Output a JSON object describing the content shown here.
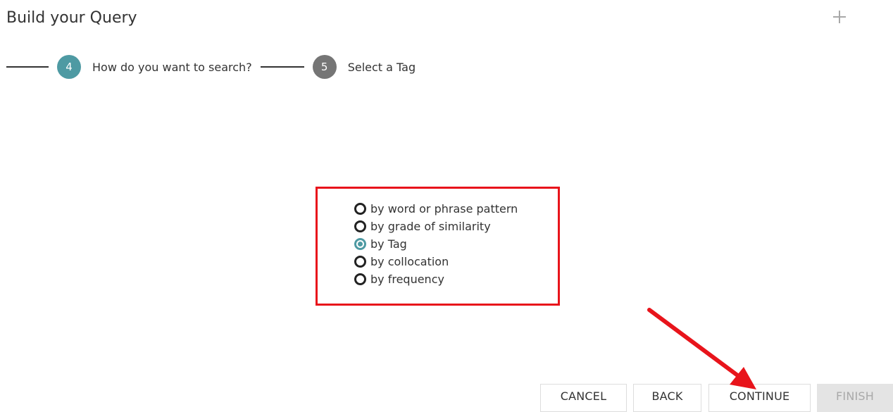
{
  "header": {
    "title": "Build your Query",
    "add_icon": "plus-icon"
  },
  "stepper": {
    "steps": [
      {
        "number": "4",
        "label": "How do you want to search?",
        "state": "active"
      },
      {
        "number": "5",
        "label": "Select a Tag",
        "state": "inactive"
      }
    ]
  },
  "search_options": {
    "items": [
      {
        "label": "by word or phrase pattern",
        "selected": false
      },
      {
        "label": "by grade of similarity",
        "selected": false
      },
      {
        "label": "by Tag",
        "selected": true
      },
      {
        "label": "by collocation",
        "selected": false
      },
      {
        "label": "by frequency",
        "selected": false
      }
    ]
  },
  "footer": {
    "cancel_label": "CANCEL",
    "back_label": "BACK",
    "continue_label": "CONTINUE",
    "finish_label": "FINISH"
  },
  "colors": {
    "accent": "#4e9aa3",
    "inactive_step": "#757575",
    "highlight": "#e8141b",
    "disabled_button": "#e4e4e4"
  }
}
